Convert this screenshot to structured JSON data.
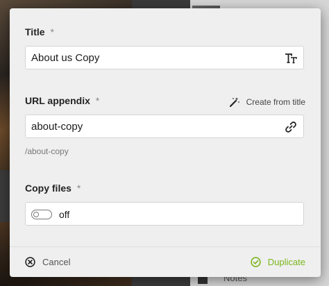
{
  "dialog": {
    "title_field": {
      "label": "Title",
      "required_mark": "*",
      "value": "About us Copy",
      "icon": "text-format-icon"
    },
    "url_field": {
      "label": "URL appendix",
      "required_mark": "*",
      "value": "about-copy",
      "help": "/about-copy",
      "icon": "link-icon",
      "create_from_title": "Create from title",
      "create_icon": "magic-wand-icon"
    },
    "copy_files_field": {
      "label": "Copy files",
      "required_mark": "*",
      "toggle_state": "off"
    },
    "footer": {
      "cancel_label": "Cancel",
      "duplicate_label": "Duplicate"
    },
    "colors": {
      "accent": "#7ab51d",
      "dialog_bg": "#efefef"
    }
  },
  "background": {
    "right_label": "Notes"
  }
}
